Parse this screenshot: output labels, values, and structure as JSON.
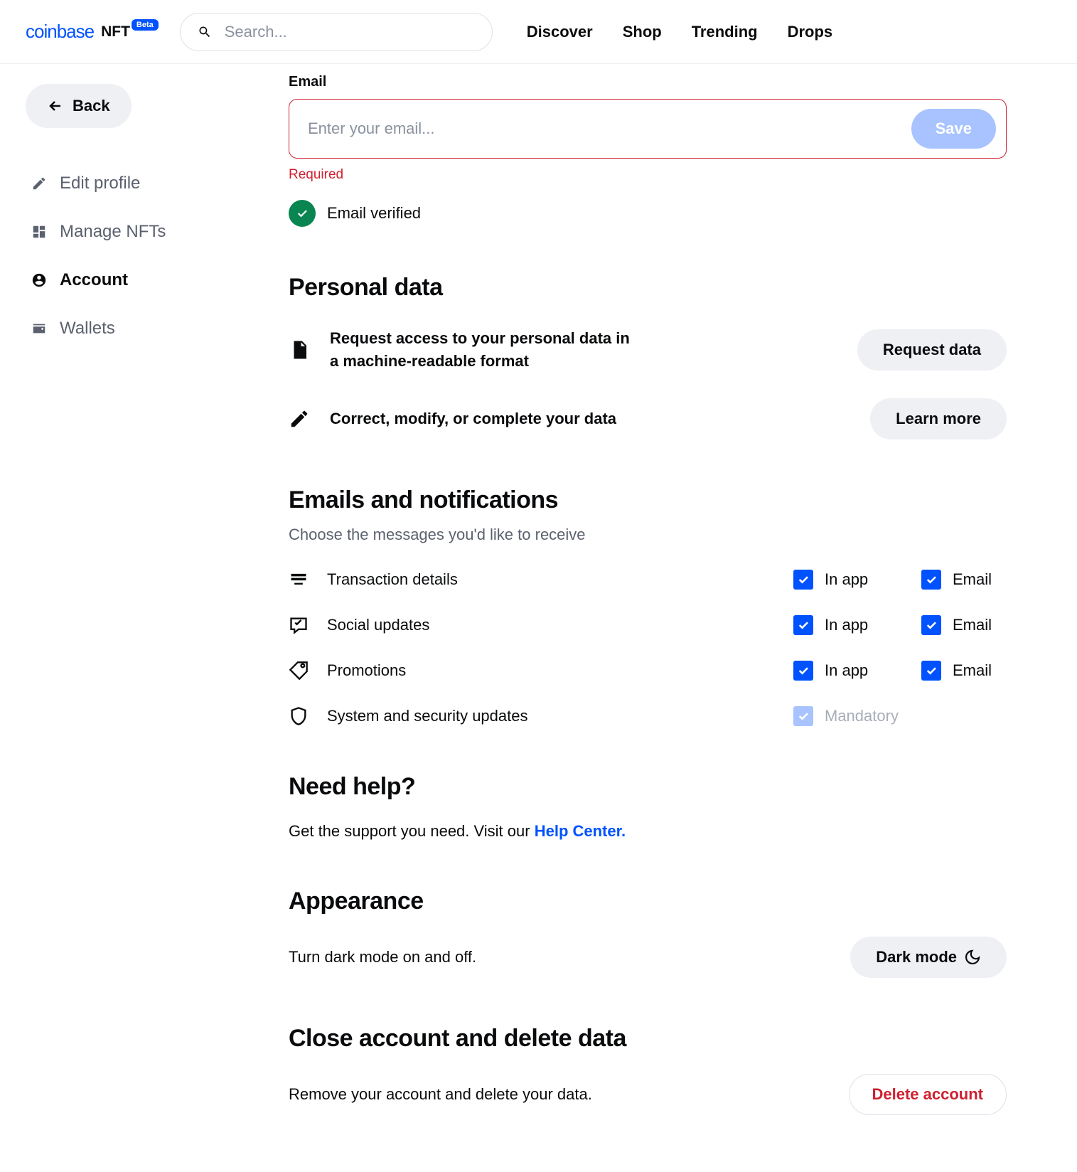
{
  "header": {
    "logo_main": "coinbase",
    "logo_nft": "NFT",
    "beta": "Beta",
    "search_placeholder": "Search...",
    "nav": {
      "discover": "Discover",
      "shop": "Shop",
      "trending": "Trending",
      "drops": "Drops"
    }
  },
  "sidebar": {
    "back": "Back",
    "items": {
      "edit_profile": "Edit profile",
      "manage_nfts": "Manage NFTs",
      "account": "Account",
      "wallets": "Wallets"
    }
  },
  "email": {
    "label": "Email",
    "placeholder": "Enter your email...",
    "save": "Save",
    "required": "Required",
    "verified": "Email verified"
  },
  "personal": {
    "title": "Personal data",
    "row1": "Request access to your personal data in a machine-readable format",
    "btn1": "Request data",
    "row2": "Correct, modify, or complete your data",
    "btn2": "Learn more"
  },
  "notif": {
    "title": "Emails and notifications",
    "sub": "Choose the messages you'd like to receive",
    "rows": {
      "transaction": "Transaction details",
      "social": "Social updates",
      "promotions": "Promotions",
      "system": "System and security updates"
    },
    "inapp": "In app",
    "email": "Email",
    "mandatory": "Mandatory"
  },
  "help": {
    "title": "Need help?",
    "text": "Get the support you need. Visit our ",
    "link": "Help Center."
  },
  "appearance": {
    "title": "Appearance",
    "text": "Turn dark mode on and off.",
    "btn": "Dark mode"
  },
  "close": {
    "title": "Close account and delete data",
    "text": "Remove your account and delete your data.",
    "btn": "Delete account"
  }
}
